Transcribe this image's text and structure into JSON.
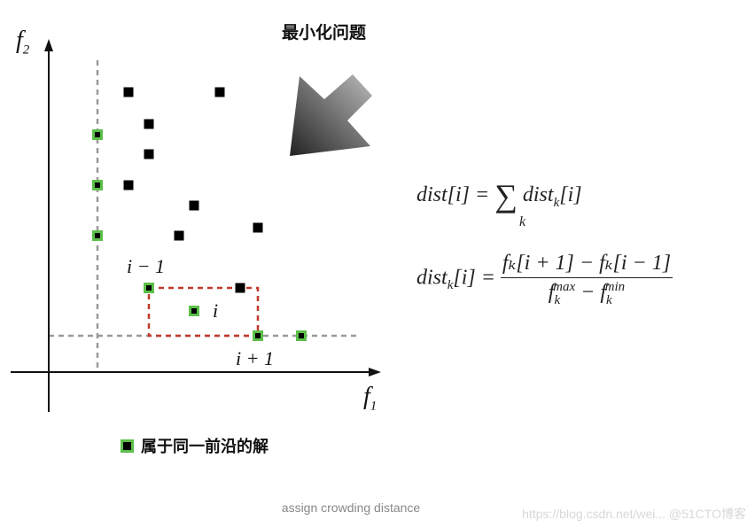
{
  "title": "最小化问题",
  "axes": {
    "x_label": "f",
    "x_sub": "1",
    "y_label": "f",
    "y_sub": "2"
  },
  "point_labels": {
    "prev": "i − 1",
    "current": "i",
    "next": "i + 1"
  },
  "formula1": {
    "lhs": "dist[i] =",
    "sum": "∑",
    "sum_index": "k",
    "rhs_main": "dist",
    "rhs_sub": "k",
    "rhs_tail": "[i]"
  },
  "formula2": {
    "lhs_main": "dist",
    "lhs_sub": "k",
    "lhs_tail": "[i] =",
    "numerator": "fₖ[i + 1] − fₖ[i − 1]",
    "den_a": "f",
    "den_a_sup": "max",
    "den_a_sub": "k",
    "den_minus": " − ",
    "den_b": "f",
    "den_b_sup": "min",
    "den_b_sub": "k"
  },
  "legend": {
    "label": "属于同一前沿的解",
    "marker_color": "#5cbf4a"
  },
  "caption": "assign crowding distance",
  "watermark": "https://blog.csdn.net/wei... @51CTO博客",
  "colors": {
    "front_border": "#5cbf4a",
    "point": "#000000",
    "crowding_box": "#c0392b",
    "guides": "#999999"
  }
}
